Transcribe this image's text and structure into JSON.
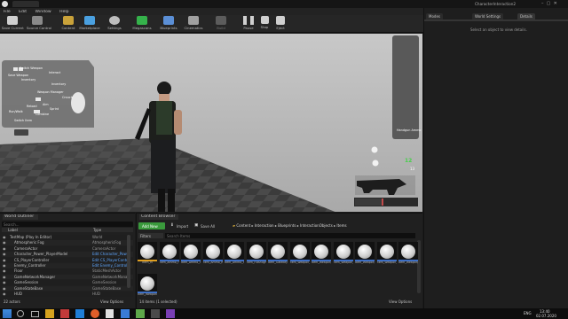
{
  "window": {
    "title": "CharacterInteraction2"
  },
  "menu": [
    "File",
    "Edit",
    "Window",
    "Help"
  ],
  "toolbar": [
    {
      "label": "Save Current",
      "icon": "save-icon",
      "color": "#cfcfcf"
    },
    {
      "label": "Source Control",
      "icon": "source-control-icon",
      "color": "#9a9a9a"
    },
    {
      "label": "Content",
      "icon": "content-icon",
      "color": "#c9a23a"
    },
    {
      "label": "Marketplace",
      "icon": "marketplace-icon",
      "color": "#4aa0e0"
    },
    {
      "label": "Settings",
      "icon": "gear-icon",
      "color": "#bdbdbd"
    },
    {
      "label": "Megascans",
      "icon": "megascans-icon",
      "color": "#35b24b"
    },
    {
      "label": "Blueprints",
      "icon": "blueprints-icon",
      "color": "#5b8fd6"
    },
    {
      "label": "Cinematics",
      "icon": "cinematics-icon",
      "color": "#aaaaaa"
    },
    {
      "label": "Build",
      "icon": "build-icon",
      "color": "#6b6b6b"
    },
    {
      "label": "Pause",
      "icon": "pause-icon",
      "color": "#d0d0d0"
    },
    {
      "label": "Stop",
      "icon": "stop-icon",
      "color": "#d0d0d0"
    },
    {
      "label": "Eject",
      "icon": "eject-icon",
      "color": "#d0d0d0"
    }
  ],
  "right_panel": {
    "tabs": [
      "Modes",
      "World Settings",
      "Details"
    ],
    "empty_message": "Select an object to view details."
  },
  "hud": {
    "radial_labels": [
      "Switch Weapon",
      "Interact",
      "Save Weapon",
      "Inventory",
      "Weapon Manager",
      "Inventory",
      "Crouch",
      "Aim",
      "Sprint",
      "Run/Walk",
      "Reload",
      "Combine",
      "Switch Item"
    ],
    "ammo_label": "Handgun Ammo",
    "ammo_count": "12",
    "count_small": "13"
  },
  "outliner": {
    "title": "World Outliner",
    "search_placeholder": "Search...",
    "columns": [
      "Label",
      "Type"
    ],
    "rows": [
      {
        "label": "TestMap (Play In Editor)",
        "type": "World"
      },
      {
        "label": "Atmospheric Fog",
        "type": "AtmosphericFog"
      },
      {
        "label": "CameraActor",
        "type": "CameraActor"
      },
      {
        "label": "Character_Power_PlayerModel",
        "type": "Edit Character_Pow"
      },
      {
        "label": "CS_PlayerController",
        "type": "Edit CS_PlayerContr"
      },
      {
        "label": "Enemy_Controller",
        "type": "Edit Enemy_Control"
      },
      {
        "label": "Floor",
        "type": "StaticMeshActor"
      },
      {
        "label": "GameNetworkManager",
        "type": "GameNetworkMana"
      },
      {
        "label": "GameSession",
        "type": "GameSession"
      },
      {
        "label": "GameStateBase",
        "type": "GameStateBase"
      },
      {
        "label": "HUD",
        "type": "HUD"
      }
    ],
    "footer_count": "22 actors",
    "view_options": "View Options"
  },
  "content_browser": {
    "title": "Content Browser",
    "add_new": "Add New",
    "import": "Import",
    "save_all": "Save All",
    "breadcrumb": [
      "Content",
      "Interaction",
      "Blueprints",
      "InteractionObjects",
      "Items"
    ],
    "filters": "Filters",
    "search_placeholder": "Search Items",
    "assets": [
      "Item_M",
      "Item_Ammo_Handgun",
      "Item_Ammo_Shotgun",
      "Item_Ammo_Rifle",
      "Item_Ammo_Shotgun",
      "Item_Flashlight",
      "Item_Gatekey",
      "Item_Weapon_Knife",
      "Item_Weapon_Rifle",
      "Item_Weapon_Handgun",
      "Item_Weapon_Shotgun",
      "Item_Weapon_Sniper",
      "Item_Weapon_Shotgun",
      "Item_Weapon"
    ],
    "footer_count": "14 items (1 selected)",
    "view_options": "View Options"
  },
  "taskbar": {
    "language": "ENG",
    "time": "13:40",
    "date": "02.07.2020"
  }
}
